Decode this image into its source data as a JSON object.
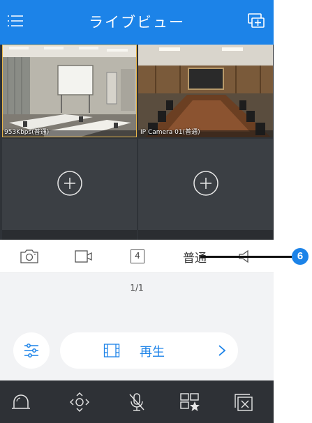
{
  "header": {
    "title": "ライブビュー",
    "menu_icon": "menu-icon",
    "screen_icon": "multi-screen-icon"
  },
  "grid": {
    "cells": [
      {
        "label": "953Kbps(普通)",
        "state": "live",
        "scene": "meeting-room-whiteboard"
      },
      {
        "label": "IP Camera 01(普通)",
        "state": "live",
        "scene": "conference-table"
      },
      {
        "label": "",
        "state": "empty",
        "icon": "add-circle-icon"
      },
      {
        "label": "",
        "state": "empty",
        "icon": "add-circle-icon"
      }
    ]
  },
  "toolbar": {
    "snapshot_icon": "camera-icon",
    "record_icon": "video-record-icon",
    "split_value": "4",
    "quality_label": "普通",
    "audio_icon": "speaker-icon"
  },
  "page_indicator": "1/1",
  "playback": {
    "label": "再生",
    "icon": "film-icon",
    "arrow_icon": "chevron-right-icon"
  },
  "filter_icon": "sliders-icon",
  "bottom_bar": {
    "items": [
      "alarm-icon",
      "ptz-icon",
      "mic-off-icon",
      "favorite-icon",
      "close-all-icon"
    ]
  },
  "callout": {
    "number": "6"
  },
  "colors": {
    "primary": "#1c83e8",
    "dark_bar": "#2e3136",
    "grid_bg": "#2f3338",
    "active_border": "#e8b548"
  }
}
